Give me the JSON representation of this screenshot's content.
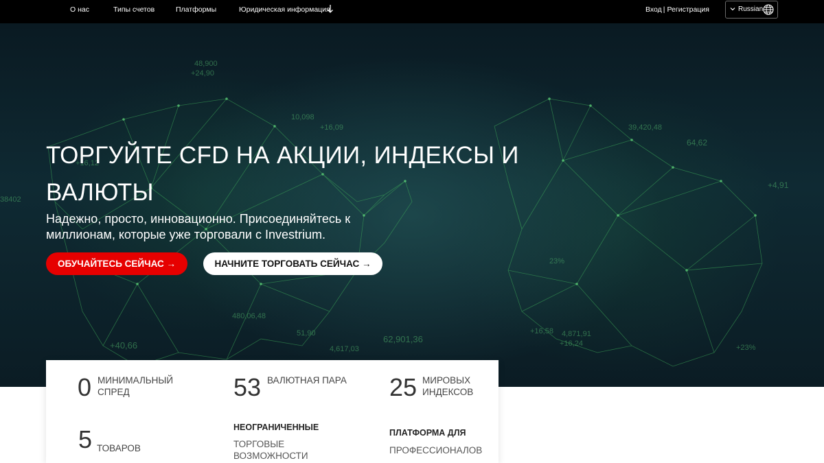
{
  "nav": {
    "items": [
      "О нас",
      "Типы счетов",
      "Платформы",
      "Юридическая информация"
    ],
    "login": "Вход",
    "separator": "|",
    "register": "Регистрация",
    "language": "Russian"
  },
  "hero": {
    "title": "ТОРГУЙТЕ CFD НА АКЦИИ, ИНДЕКСЫ И ВАЛЮТЫ",
    "subtitle": "Надежно, просто, инновационно. Присоединяйтесь к миллионам, которые уже торговали с Investrium.",
    "cta_primary": "ОБУЧАЙТЕСЬ СЕЙЧАС →",
    "cta_secondary": "НАЧНИТЕ ТОРГОВАТЬ СЕЙЧАС →",
    "background_numbers": [
      "48,900",
      "+24,90",
      "10,098",
      "+16,09",
      "+16,12",
      "38402",
      "+40,66",
      "480,06,48",
      "51,90",
      "4,617,03",
      "62,901,36",
      "64,62",
      "+4,91",
      "23%",
      "39,420,48",
      "+16,58",
      "4,871,91",
      "+16,24",
      "+23%"
    ]
  },
  "stats": {
    "spread_num": "0",
    "spread_label": "МИНИМАЛЬНЫЙ СПРЕД",
    "pairs_num": "53",
    "pairs_label": "ВАЛЮТНАЯ ПАРА",
    "indices_num": "25",
    "indices_label": "МИРОВЫХ ИНДЕКСОВ",
    "goods_num": "5",
    "goods_label": "ТОВАРОВ",
    "unlimited_bold": "НЕОГРАНИЧЕННЫЕ",
    "unlimited_label": "ТОРГОВЫЕ ВОЗМОЖНОСТИ",
    "platform_bold": "ПЛАТФОРМА ДЛЯ",
    "platform_label": "ПРОФЕССИОНАЛОВ"
  },
  "colors": {
    "nav_bg": "#000000",
    "accent_red": "#e60000",
    "hero_green": "#3fae5a"
  }
}
